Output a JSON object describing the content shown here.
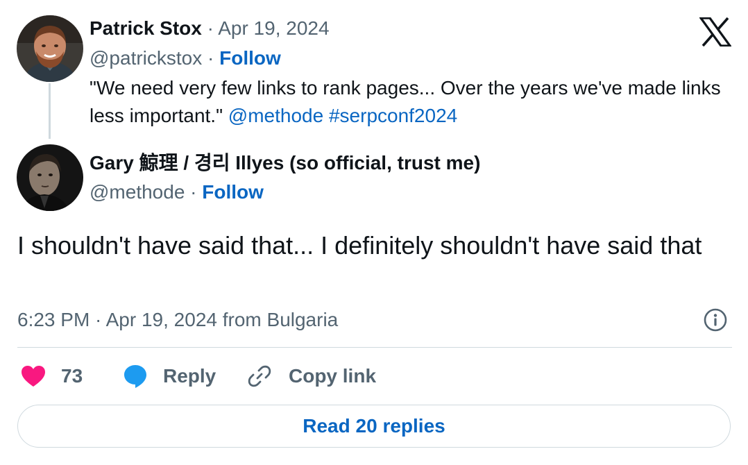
{
  "brand": {
    "logo_icon": "x-logo-icon"
  },
  "quoted_tweet": {
    "author_name": "Patrick Stox",
    "separator": " · ",
    "date": "Apr 19, 2024",
    "handle": "@patrickstox",
    "follow_label": "Follow",
    "text": "\"We need very few links to rank pages... Over the years we've made links less important.\"",
    "mention": "@methode",
    "hashtag": "#serpconf2024"
  },
  "main_tweet": {
    "author_name": "Gary 鯨理 / 경리 Illyes (so official, trust me)",
    "handle": "@methode",
    "separator": " · ",
    "follow_label": "Follow",
    "text": "I shouldn't have said that... I definitely shouldn't have said that",
    "timestamp": "6:23 PM · Apr 19, 2024 from Bulgaria"
  },
  "actions": {
    "like_count": "73",
    "reply_label": "Reply",
    "copy_link_label": "Copy link"
  },
  "read_replies_label": "Read 20 replies",
  "colors": {
    "link_blue": "#0a66c2",
    "like_pink": "#f91880",
    "reply_blue": "#1d9bf0",
    "muted": "#536471",
    "divider": "#cfd9de"
  }
}
